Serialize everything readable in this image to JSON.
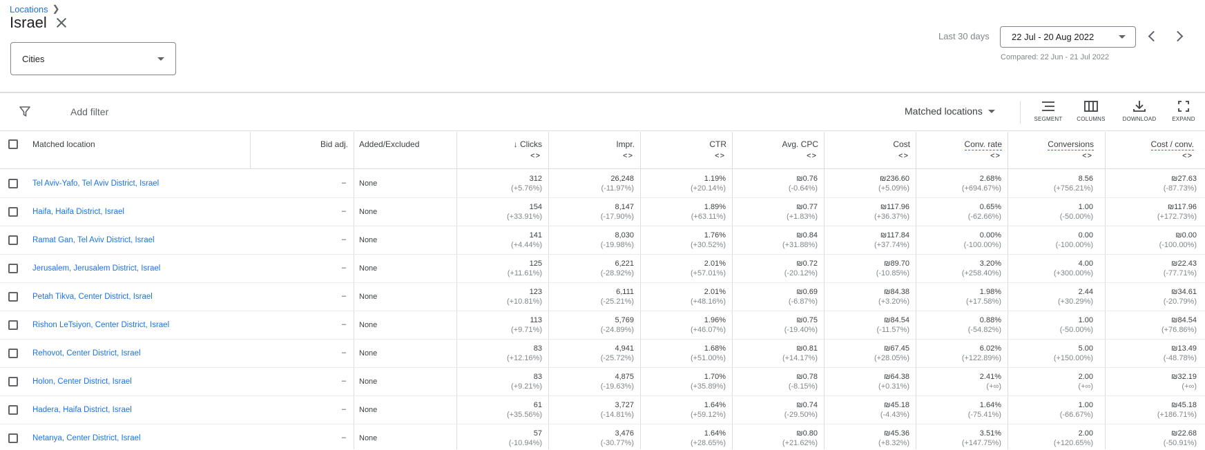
{
  "header": {
    "breadcrumb": "Locations",
    "title": "Israel",
    "select_value": "Cities",
    "date_label": "Last 30 days",
    "date_range": "22 Jul - 20 Aug 2022",
    "compared": "Compared: 22 Jun - 21 Jul 2022"
  },
  "toolbar": {
    "add_filter": "Add filter",
    "matched_locations": "Matched locations",
    "segment": "SEGMENT",
    "columns": "COLUMNS",
    "download": "DOWNLOAD",
    "expand": "EXPAND"
  },
  "columns": {
    "location": "Matched location",
    "bid_adj": "Bid adj.",
    "added": "Added/Excluded",
    "clicks": "Clicks",
    "impr": "Impr.",
    "ctr": "CTR",
    "avg_cpc": "Avg. CPC",
    "cost": "Cost",
    "conv_rate": "Conv. rate",
    "conversions": "Conversions",
    "cost_conv": "Cost / conv.",
    "sort_arrows": "<>",
    "sort_down": "↓"
  },
  "rows": [
    {
      "location": "Tel Aviv-Yafo, Tel Aviv District, Israel",
      "bid": "–",
      "added": "None",
      "clicks": "312",
      "clicks_c": "(+5.76%)",
      "impr": "26,248",
      "impr_c": "(-11.97%)",
      "ctr": "1.19%",
      "ctr_c": "(+20.14%)",
      "cpc": "₪0.76",
      "cpc_c": "(-0.64%)",
      "cost": "₪236.60",
      "cost_c": "(+5.09%)",
      "cr": "2.68%",
      "cr_c": "(+694.67%)",
      "conv": "8.56",
      "conv_c": "(+756.21%)",
      "cpa": "₪27.63",
      "cpa_c": "(-87.73%)"
    },
    {
      "location": "Haifa, Haifa District, Israel",
      "bid": "–",
      "added": "None",
      "clicks": "154",
      "clicks_c": "(+33.91%)",
      "impr": "8,147",
      "impr_c": "(-17.90%)",
      "ctr": "1.89%",
      "ctr_c": "(+63.11%)",
      "cpc": "₪0.77",
      "cpc_c": "(+1.83%)",
      "cost": "₪117.96",
      "cost_c": "(+36.37%)",
      "cr": "0.65%",
      "cr_c": "(-62.66%)",
      "conv": "1.00",
      "conv_c": "(-50.00%)",
      "cpa": "₪117.96",
      "cpa_c": "(+172.73%)"
    },
    {
      "location": "Ramat Gan, Tel Aviv District, Israel",
      "bid": "–",
      "added": "None",
      "clicks": "141",
      "clicks_c": "(+4.44%)",
      "impr": "8,030",
      "impr_c": "(-19.98%)",
      "ctr": "1.76%",
      "ctr_c": "(+30.52%)",
      "cpc": "₪0.84",
      "cpc_c": "(+31.88%)",
      "cost": "₪117.84",
      "cost_c": "(+37.74%)",
      "cr": "0.00%",
      "cr_c": "(-100.00%)",
      "conv": "0.00",
      "conv_c": "(-100.00%)",
      "cpa": "₪0.00",
      "cpa_c": "(-100.00%)"
    },
    {
      "location": "Jerusalem, Jerusalem District, Israel",
      "bid": "–",
      "added": "None",
      "clicks": "125",
      "clicks_c": "(+11.61%)",
      "impr": "6,221",
      "impr_c": "(-28.92%)",
      "ctr": "2.01%",
      "ctr_c": "(+57.01%)",
      "cpc": "₪0.72",
      "cpc_c": "(-20.12%)",
      "cost": "₪89.70",
      "cost_c": "(-10.85%)",
      "cr": "3.20%",
      "cr_c": "(+258.40%)",
      "conv": "4.00",
      "conv_c": "(+300.00%)",
      "cpa": "₪22.43",
      "cpa_c": "(-77.71%)"
    },
    {
      "location": "Petah Tikva, Center District, Israel",
      "bid": "–",
      "added": "None",
      "clicks": "123",
      "clicks_c": "(+10.81%)",
      "impr": "6,111",
      "impr_c": "(-25.21%)",
      "ctr": "2.01%",
      "ctr_c": "(+48.16%)",
      "cpc": "₪0.69",
      "cpc_c": "(-6.87%)",
      "cost": "₪84.38",
      "cost_c": "(+3.20%)",
      "cr": "1.98%",
      "cr_c": "(+17.58%)",
      "conv": "2.44",
      "conv_c": "(+30.29%)",
      "cpa": "₪34.61",
      "cpa_c": "(-20.79%)"
    },
    {
      "location": "Rishon LeTsiyon, Center District, Israel",
      "bid": "–",
      "added": "None",
      "clicks": "113",
      "clicks_c": "(+9.71%)",
      "impr": "5,769",
      "impr_c": "(-24.89%)",
      "ctr": "1.96%",
      "ctr_c": "(+46.07%)",
      "cpc": "₪0.75",
      "cpc_c": "(-19.40%)",
      "cost": "₪84.54",
      "cost_c": "(-11.57%)",
      "cr": "0.88%",
      "cr_c": "(-54.82%)",
      "conv": "1.00",
      "conv_c": "(-50.00%)",
      "cpa": "₪84.54",
      "cpa_c": "(+76.86%)"
    },
    {
      "location": "Rehovot, Center District, Israel",
      "bid": "–",
      "added": "None",
      "clicks": "83",
      "clicks_c": "(+12.16%)",
      "impr": "4,941",
      "impr_c": "(-25.72%)",
      "ctr": "1.68%",
      "ctr_c": "(+51.00%)",
      "cpc": "₪0.81",
      "cpc_c": "(+14.17%)",
      "cost": "₪67.45",
      "cost_c": "(+28.05%)",
      "cr": "6.02%",
      "cr_c": "(+122.89%)",
      "conv": "5.00",
      "conv_c": "(+150.00%)",
      "cpa": "₪13.49",
      "cpa_c": "(-48.78%)"
    },
    {
      "location": "Holon, Center District, Israel",
      "bid": "–",
      "added": "None",
      "clicks": "83",
      "clicks_c": "(+9.21%)",
      "impr": "4,875",
      "impr_c": "(-19.63%)",
      "ctr": "1.70%",
      "ctr_c": "(+35.89%)",
      "cpc": "₪0.78",
      "cpc_c": "(-8.15%)",
      "cost": "₪64.38",
      "cost_c": "(+0.31%)",
      "cr": "2.41%",
      "cr_c": "(+∞)",
      "conv": "2.00",
      "conv_c": "(+∞)",
      "cpa": "₪32.19",
      "cpa_c": "(+∞)"
    },
    {
      "location": "Hadera, Haifa District, Israel",
      "bid": "–",
      "added": "None",
      "clicks": "61",
      "clicks_c": "(+35.56%)",
      "impr": "3,727",
      "impr_c": "(-14.81%)",
      "ctr": "1.64%",
      "ctr_c": "(+59.12%)",
      "cpc": "₪0.74",
      "cpc_c": "(-29.50%)",
      "cost": "₪45.18",
      "cost_c": "(-4.43%)",
      "cr": "1.64%",
      "cr_c": "(-75.41%)",
      "conv": "1.00",
      "conv_c": "(-66.67%)",
      "cpa": "₪45.18",
      "cpa_c": "(+186.71%)"
    },
    {
      "location": "Netanya, Center District, Israel",
      "bid": "–",
      "added": "None",
      "clicks": "57",
      "clicks_c": "(-10.94%)",
      "impr": "3,476",
      "impr_c": "(-30.77%)",
      "ctr": "1.64%",
      "ctr_c": "(+28.65%)",
      "cpc": "₪0.80",
      "cpc_c": "(+21.62%)",
      "cost": "₪45.36",
      "cost_c": "(+8.32%)",
      "cr": "3.51%",
      "cr_c": "(+147.75%)",
      "conv": "2.00",
      "conv_c": "(+120.65%)",
      "cpa": "₪22.68",
      "cpa_c": "(-50.91%)"
    }
  ]
}
